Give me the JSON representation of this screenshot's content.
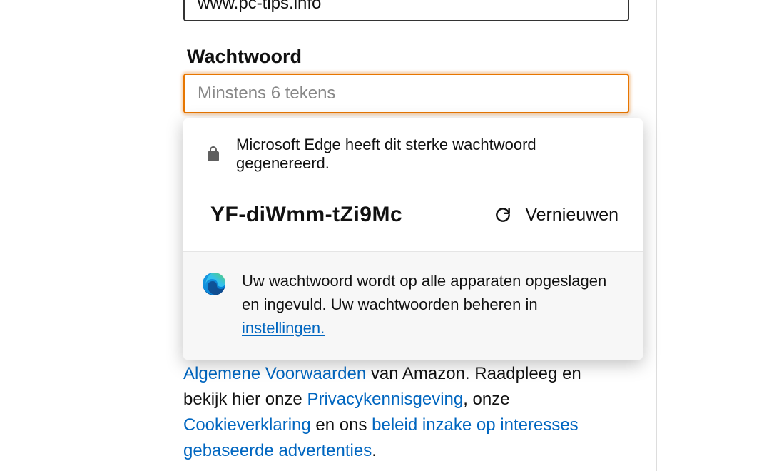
{
  "form": {
    "url_value": "www.pc-tips.info",
    "password_label": "Wachtwoord",
    "password_placeholder": "Minstens 6 tekens"
  },
  "popup": {
    "header_text": "Microsoft Edge heeft dit sterke wachtwoord gegenereerd.",
    "generated_password": "YF-diWmm-tZi9Mc",
    "refresh_label": "Vernieuwen",
    "footer_text_1": "Uw wachtwoord wordt op alle apparaten opgeslagen en ingevuld. Uw wachtwoorden beheren in  ",
    "settings_link": "instellingen."
  },
  "legal": {
    "algemene": "Algemene Voorwaarden",
    "text_1": " van Amazon. Raadpleeg en bekijk hier onze ",
    "privacy": "Privacykennisgeving",
    "text_2": ", onze ",
    "cookie": "Cookieverklaring",
    "text_3": " en ons ",
    "beleid": "beleid inzake op interesses gebaseerde advertenties",
    "text_4": "."
  }
}
